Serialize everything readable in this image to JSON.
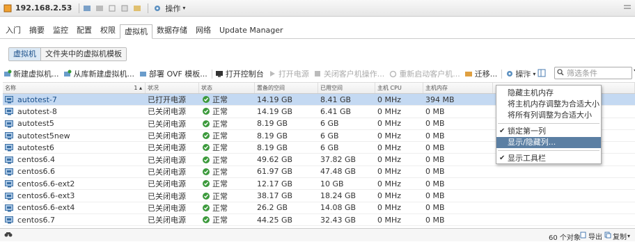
{
  "host_bar": {
    "host": "192.168.2.53",
    "actions_label": "操作"
  },
  "tabs": [
    "入门",
    "摘要",
    "监控",
    "配置",
    "权限",
    "虚拟机",
    "数据存储",
    "网络",
    "Update Manager"
  ],
  "subtabs": [
    "虚拟机",
    "文件夹中的虚拟机模板"
  ],
  "toolbar": {
    "new_vm": "新建虚拟机...",
    "new_from_library": "从库新建虚拟机...",
    "deploy_ovf": "部署 OVF 模板...",
    "open_console": "打开控制台",
    "power_on": "打开电源",
    "shutdown_guest": "关闭客户机操作...",
    "restart_guest": "重新启动客户机...",
    "migrate": "迁移...",
    "actions": "操作",
    "filter_placeholder": "筛选条件"
  },
  "grid": {
    "headers": [
      "名称",
      "状况",
      "状态",
      "置备的空间",
      "已用空间",
      "主机 CPU",
      "主机内存"
    ],
    "sort_indicator": "1 ▴",
    "rows": [
      {
        "name": "autotest-7",
        "state": "已打开电源",
        "status": "正常",
        "provisioned": "14.19 GB",
        "used": "8.41 GB",
        "cpu": "0 MHz",
        "mem": "394 MB"
      },
      {
        "name": "autotest-8",
        "state": "已关闭电源",
        "status": "正常",
        "provisioned": "14.19 GB",
        "used": "6.41 GB",
        "cpu": "0 MHz",
        "mem": "0 MB"
      },
      {
        "name": "autotest5",
        "state": "已关闭电源",
        "status": "正常",
        "provisioned": "8.19 GB",
        "used": "6 GB",
        "cpu": "0 MHz",
        "mem": "0 MB"
      },
      {
        "name": "autotest5new",
        "state": "已关闭电源",
        "status": "正常",
        "provisioned": "8.19 GB",
        "used": "6 GB",
        "cpu": "0 MHz",
        "mem": "0 MB"
      },
      {
        "name": "autotest6",
        "state": "已关闭电源",
        "status": "正常",
        "provisioned": "8.19 GB",
        "used": "6 GB",
        "cpu": "0 MHz",
        "mem": "0 MB"
      },
      {
        "name": "centos6.4",
        "state": "已关闭电源",
        "status": "正常",
        "provisioned": "49.62 GB",
        "used": "37.82 GB",
        "cpu": "0 MHz",
        "mem": "0 MB"
      },
      {
        "name": "centos6.6",
        "state": "已关闭电源",
        "status": "正常",
        "provisioned": "61.97 GB",
        "used": "47.48 GB",
        "cpu": "0 MHz",
        "mem": "0 MB"
      },
      {
        "name": "centos6.6-ext2",
        "state": "已关闭电源",
        "status": "正常",
        "provisioned": "12.17 GB",
        "used": "10 GB",
        "cpu": "0 MHz",
        "mem": "0 MB"
      },
      {
        "name": "centos6.6-ext3",
        "state": "已关闭电源",
        "status": "正常",
        "provisioned": "38.17 GB",
        "used": "18.24 GB",
        "cpu": "0 MHz",
        "mem": "0 MB"
      },
      {
        "name": "centos6.6-ext4",
        "state": "已关闭电源",
        "status": "正常",
        "provisioned": "26.2 GB",
        "used": "14.08 GB",
        "cpu": "0 MHz",
        "mem": "0 MB"
      },
      {
        "name": "centos6.7",
        "state": "已关闭电源",
        "status": "正常",
        "provisioned": "44.25 GB",
        "used": "32.43 GB",
        "cpu": "0 MHz",
        "mem": "0 MB"
      }
    ]
  },
  "context_menu": {
    "items": [
      {
        "label": "隐藏主机内存",
        "checked": false
      },
      {
        "label": "将主机内存调整为合适大小",
        "checked": false
      },
      {
        "label": "将所有列调整为合适大小",
        "checked": false
      },
      {
        "label": "锁定第一列",
        "checked": true
      },
      {
        "label": "显示/隐藏列...",
        "checked": false,
        "highlighted": true
      },
      {
        "label": "显示工具栏",
        "checked": true
      }
    ]
  },
  "footer": {
    "count": "60 个对象",
    "export": "导出",
    "copy": "复制"
  },
  "colors": {
    "selected_row": "#c4d9f2",
    "menu_highlight": "#5b7fa3",
    "ok_green": "#3c9a3c"
  }
}
